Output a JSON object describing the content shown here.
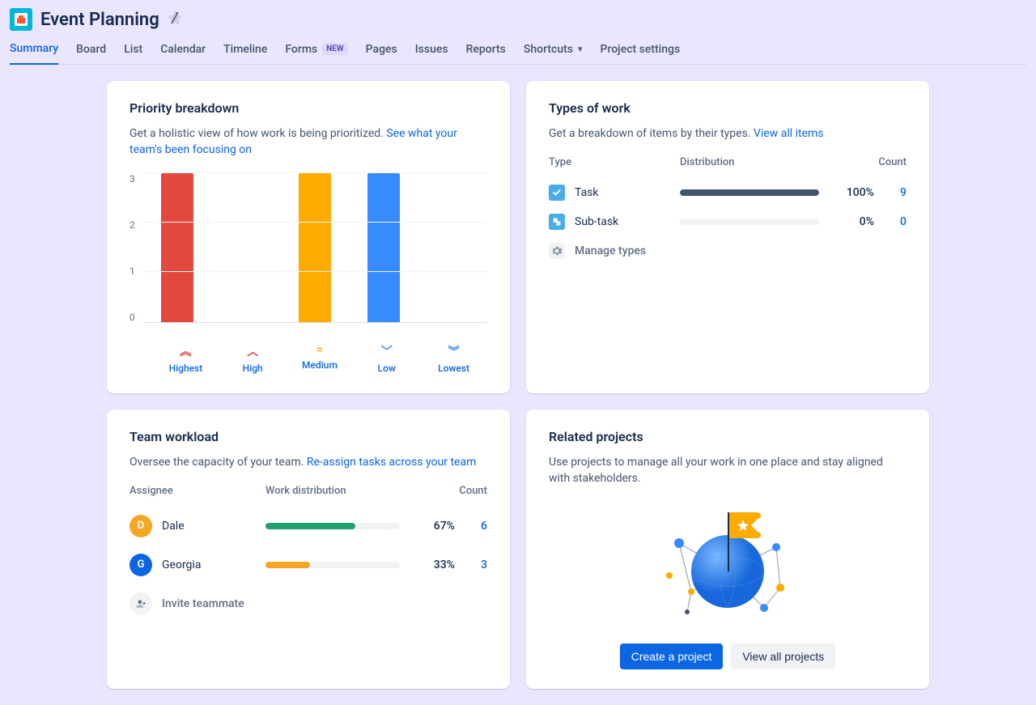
{
  "project": {
    "title": "Event Planning"
  },
  "nav": {
    "tabs": [
      {
        "label": "Summary",
        "active": true
      },
      {
        "label": "Board"
      },
      {
        "label": "List"
      },
      {
        "label": "Calendar"
      },
      {
        "label": "Timeline"
      },
      {
        "label": "Forms",
        "badge": "NEW"
      },
      {
        "label": "Pages"
      },
      {
        "label": "Issues"
      },
      {
        "label": "Reports"
      },
      {
        "label": "Shortcuts",
        "dropdown": true
      },
      {
        "label": "Project settings"
      }
    ]
  },
  "priority": {
    "title": "Priority breakdown",
    "desc": "Get a holistic view of how work is being prioritized. ",
    "link": "See what your team's been focusing on"
  },
  "types": {
    "title": "Types of work",
    "desc": "Get a breakdown of items by their types. ",
    "link": "View all items",
    "headers": {
      "type": "Type",
      "dist": "Distribution",
      "count": "Count"
    },
    "rows": [
      {
        "name": "Task",
        "pct": "100%",
        "count": "9",
        "fill": 100
      },
      {
        "name": "Sub-task",
        "pct": "0%",
        "count": "0",
        "fill": 0
      }
    ],
    "manage": "Manage types"
  },
  "workload": {
    "title": "Team workload",
    "desc": "Oversee the capacity of your team. ",
    "link": "Re-assign tasks across your team",
    "headers": {
      "assignee": "Assignee",
      "dist": "Work distribution",
      "count": "Count"
    },
    "rows": [
      {
        "initial": "D",
        "name": "Dale",
        "pct": "67%",
        "count": "6",
        "fill": 67,
        "color": "#F5A623",
        "barColor": "#22A06B"
      },
      {
        "initial": "G",
        "name": "Georgia",
        "pct": "33%",
        "count": "3",
        "fill": 33,
        "color": "#0C66E4",
        "barColor": "#F5A623"
      }
    ],
    "invite": "Invite teammate"
  },
  "related": {
    "title": "Related projects",
    "desc": "Use projects to manage all your work in one place and stay aligned with stakeholders.",
    "primary": "Create a project",
    "secondary": "View all projects"
  },
  "chart_data": {
    "type": "bar",
    "categories": [
      "Highest",
      "High",
      "Medium",
      "Low",
      "Lowest"
    ],
    "values": [
      3,
      0,
      3,
      3,
      0
    ],
    "colors": [
      "#E2483D",
      "#E2483D",
      "#FFAB00",
      "#388BFF",
      "#388BFF"
    ],
    "icons": [
      "double-chevron-up",
      "chevron-up",
      "equals",
      "chevron-down",
      "double-chevron-down"
    ],
    "icon_colors": [
      "#E2483D",
      "#E2483D",
      "#FFAB00",
      "#388BFF",
      "#388BFF"
    ],
    "ylim": [
      0,
      3
    ],
    "yticks": [
      0,
      1,
      2,
      3
    ]
  }
}
